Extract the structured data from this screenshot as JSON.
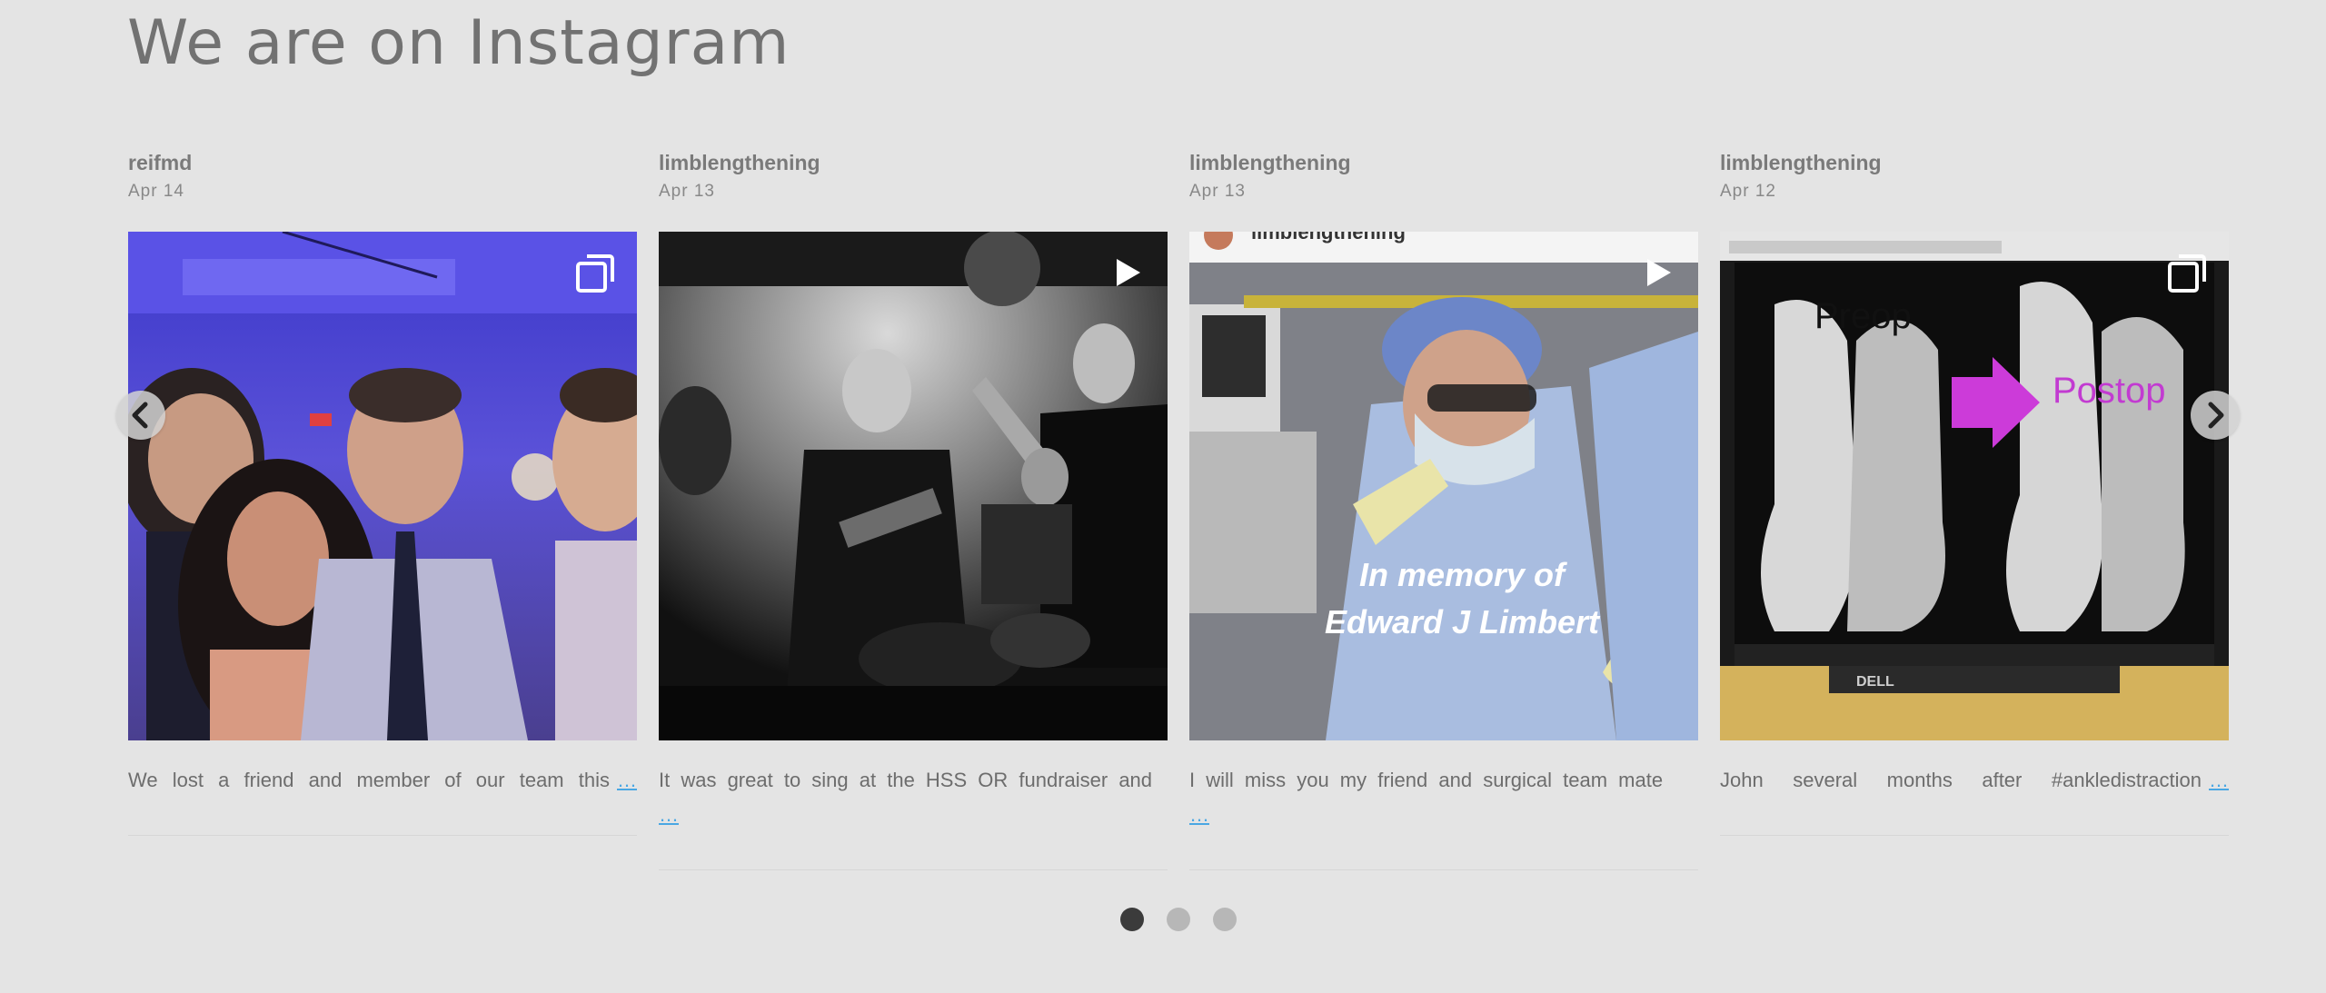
{
  "section": {
    "title": "We are on Instagram"
  },
  "posts": [
    {
      "username": "reifmd",
      "date": "Apr  14",
      "media_type": "album",
      "badge_icon": "multiple-images-icon",
      "caption": "We lost a friend and member of our team this",
      "more_link": "…"
    },
    {
      "username": "limblengthening",
      "date": "Apr  13",
      "media_type": "video",
      "badge_icon": "play-icon",
      "caption": "It was great to sing at the HSS OR fundraiser and",
      "more_link": "…"
    },
    {
      "username": "limblengthening",
      "date": "Apr  13",
      "media_type": "video",
      "badge_icon": "play-icon",
      "caption": "I will miss you my friend and surgical team mate",
      "more_link": "…",
      "image_text": {
        "header_handle": "limblengthening",
        "line1": "In memory of",
        "line2": "Edward J Limbert"
      }
    },
    {
      "username": "limblengthening",
      "date": "Apr  12",
      "media_type": "album",
      "badge_icon": "multiple-images-icon",
      "caption": "John several months after #ankledistraction",
      "more_link": "…",
      "image_text": {
        "label_pre": "Preop",
        "label_post": "Postop",
        "monitor_brand": "DELL"
      }
    }
  ],
  "carousel": {
    "prev_icon": "chevron-left-icon",
    "next_icon": "chevron-right-icon",
    "pages": 3,
    "current_page": 1
  },
  "colors": {
    "background": "#e4e4e4",
    "link": "#4aa7e3",
    "dot_active": "#3b3b3b",
    "dot_inactive": "#b7b7b7"
  }
}
